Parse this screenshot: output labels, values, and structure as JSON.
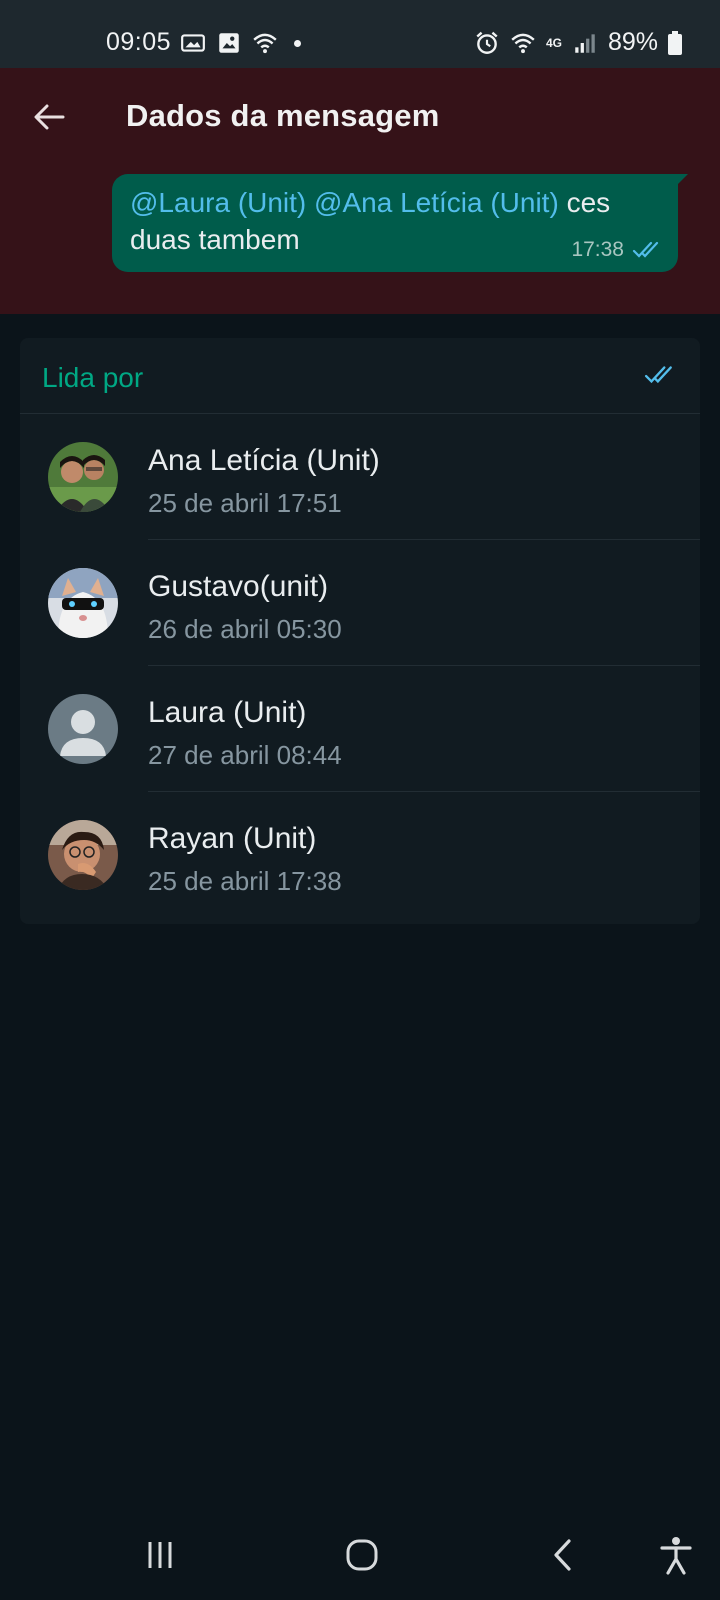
{
  "status_bar": {
    "time": "09:05",
    "battery": "89%",
    "network": "4G"
  },
  "header": {
    "title": "Dados da mensagem",
    "back_icon": "arrow-left-icon"
  },
  "message": {
    "mention_1": "@Laura (Unit)",
    "mention_2": "@Ana Letícia (Unit)",
    "text_tail_1": " ces",
    "text_line_2": "duas tambem",
    "time": "17:38",
    "status_icon": "double-check-icon"
  },
  "read_by": {
    "label": "Lida por",
    "icon": "double-check-icon",
    "entries": [
      {
        "name": "Ana Letícia (Unit)",
        "time": "25 de abril 17:51"
      },
      {
        "name": "Gustavo(unit)",
        "time": "26 de abril 05:30"
      },
      {
        "name": "Laura (Unit)",
        "time": "27 de abril 08:44"
      },
      {
        "name": "Rayan (Unit)",
        "time": "25 de abril 17:38"
      }
    ]
  },
  "colors": {
    "header_bg": "#351218",
    "bubble_bg": "#005c4b",
    "accent": "#00a884",
    "read_tick": "#53bdeb",
    "page_bg": "#0b141a"
  }
}
